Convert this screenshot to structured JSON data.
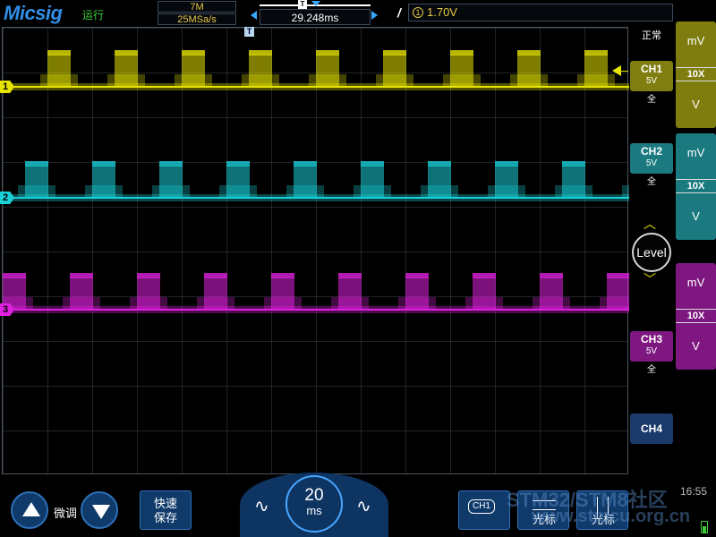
{
  "header": {
    "brand": "Micsig",
    "brand_sub": "运行",
    "memory_depth": "7M",
    "sample_rate": "25MSa/s",
    "time_offset": "29.248ms",
    "trigger_channel": "1",
    "trigger_level": "1.70V",
    "trigger_mode": "正常",
    "trigger_position_mark": "T"
  },
  "channels": [
    {
      "marker": "1",
      "name": "CH1",
      "scale": "5V",
      "bandwidth": "全",
      "probe_unit_top": "mV",
      "probe_factor": "10X",
      "probe_unit_bottom": "V",
      "color": "#e6e400"
    },
    {
      "marker": "2",
      "name": "CH2",
      "scale": "5V",
      "bandwidth": "全",
      "probe_unit_top": "mV",
      "probe_factor": "10X",
      "probe_unit_bottom": "V",
      "color": "#1ad0d8"
    },
    {
      "marker": "3",
      "name": "CH3",
      "scale": "5V",
      "bandwidth": "全",
      "probe_unit_top": "mV",
      "probe_factor": "10X",
      "probe_unit_bottom": "V",
      "color": "#e020e0"
    },
    {
      "name": "CH4"
    }
  ],
  "level_knob": {
    "label": "Level"
  },
  "bottom": {
    "fine_tune": "微调",
    "quick_save_line1": "快速",
    "quick_save_line2": "保存",
    "timebase_value": "20",
    "timebase_unit": "ms",
    "ch_select": "CH1",
    "h_cursor": "光标",
    "v_cursor": "光标",
    "clock": "16:55"
  },
  "watermark": {
    "line1": "STM32/STM8社区",
    "line2": "www.stmcu.org.cn"
  },
  "waveform": {
    "pulse_count": 9,
    "pulse_period_divisions": 1.5
  }
}
